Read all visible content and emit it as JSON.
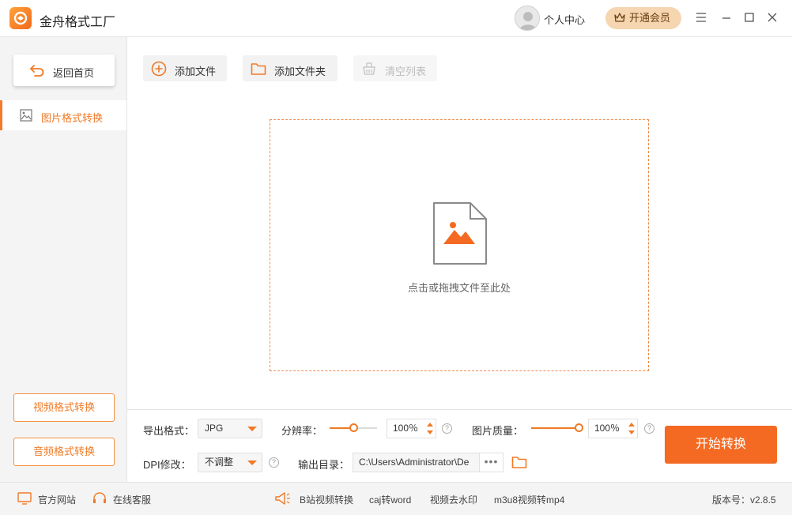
{
  "app": {
    "title": "金舟格式工厂"
  },
  "header": {
    "user_center": "个人中心",
    "vip_label": "开通会员"
  },
  "sidebar": {
    "back_label": "返回首页",
    "active_item": "图片格式转换",
    "video_convert": "视频格式转换",
    "audio_convert": "音频格式转换"
  },
  "toolbar": {
    "add_file": "添加文件",
    "add_folder": "添加文件夹",
    "clear_list": "清空列表"
  },
  "dropzone": {
    "hint": "点击或拖拽文件至此处"
  },
  "settings": {
    "export_format_label": "导出格式：",
    "export_format_value": "JPG",
    "resolution_label": "分辨率：",
    "resolution_value": "100％",
    "resolution_slider_fraction": 0.5,
    "quality_label": "图片质量：",
    "quality_value": "100％",
    "quality_slider_fraction": 1.0,
    "dpi_label": "DPI修改：",
    "dpi_value": "不调整",
    "output_dir_label": "输出目录：",
    "output_dir_value": "C:\\Users\\Administrator\\De",
    "more_label": "•••",
    "start_button": "开始转换"
  },
  "footer": {
    "official_site": "官方网站",
    "online_support": "在线客服",
    "links": [
      "B站视频转换",
      "caj转word",
      "视频去水印",
      "m3u8视频转mp4"
    ],
    "version": "版本号：v2.8.5"
  },
  "colors": {
    "accent": "#f56a22",
    "vip": "#f6d6b0"
  },
  "icons": [
    "app-logo-icon",
    "user-avatar-icon",
    "crown-icon",
    "menu-icon",
    "minimize-icon",
    "maximize-icon",
    "close-icon",
    "back-arrow-icon",
    "image-icon",
    "plus-circle-icon",
    "folder-icon",
    "basket-icon",
    "image-file-icon",
    "question-icon",
    "monitor-icon",
    "headset-icon",
    "megaphone-icon"
  ]
}
